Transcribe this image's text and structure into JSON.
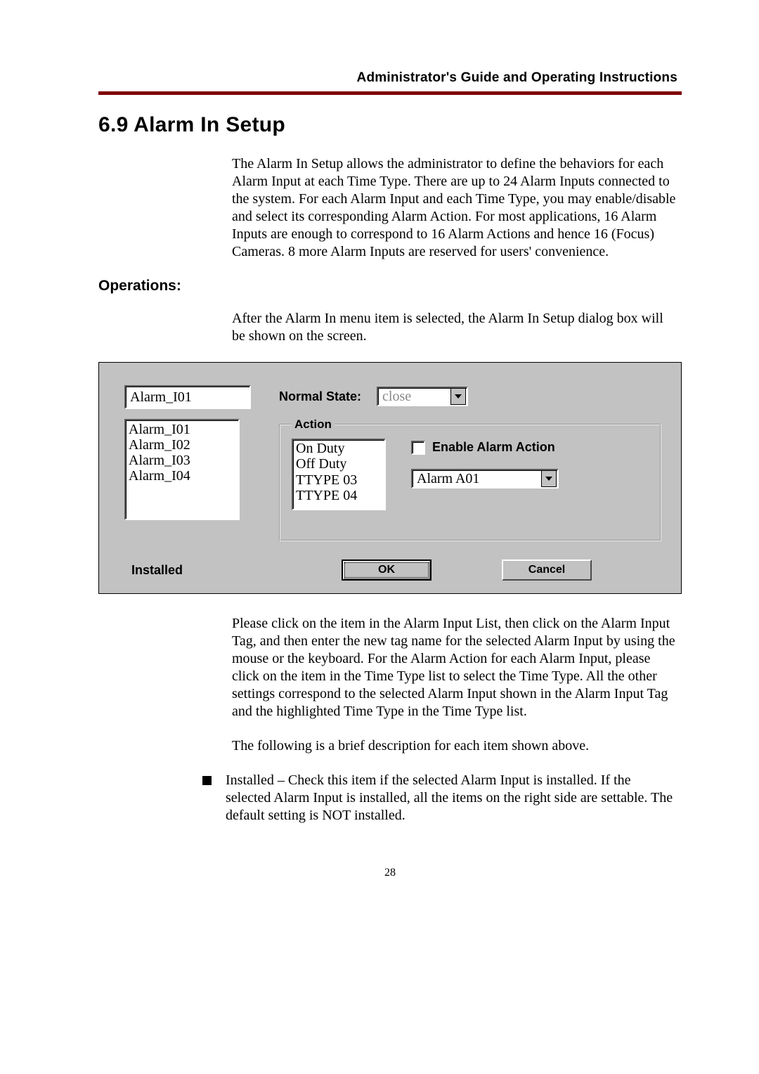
{
  "header": "Administrator's Guide and Operating Instructions",
  "section_title": "6.9 Alarm In Setup",
  "intro": "The Alarm In Setup allows the administrator to define the behaviors for each Alarm Input at each Time Type.    There are up to 24 Alarm Inputs connected to the system.    For each Alarm Input and each Time Type, you may enable/disable and select its corresponding Alarm Action.    For most applications, 16 Alarm Inputs are enough to correspond to 16 Alarm Actions and hence 16 (Focus) Cameras. 8 more Alarm Inputs are reserved for users' convenience.",
  "operations_title": "Operations:",
  "after_menu": "After the Alarm In menu item is selected, the Alarm In Setup dialog box will be shown on the screen.",
  "dialog": {
    "tag_value": "Alarm_I01",
    "ns_label": "Normal State:",
    "ns_value": "close",
    "action_legend": "Action",
    "input_list": [
      "Alarm_I01",
      "Alarm_I02",
      "Alarm_I03",
      "Alarm_I04"
    ],
    "ttype_list": [
      "On Duty",
      "Off Duty",
      "TTYPE 03",
      "TTYPE 04"
    ],
    "enable_label": "Enable Alarm Action",
    "alarm_action_value": "Alarm A01",
    "installed_label": "Installed",
    "ok": "OK",
    "cancel": "Cancel"
  },
  "post_dialog": "Please click on the item in the Alarm Input List, then click on the Alarm Input Tag, and then enter the new tag name for the selected Alarm Input by using the mouse or the keyboard.    For the Alarm Action for each Alarm Input, please click on the item in the Time Type list to select the Time Type.    All the other settings correspond to the selected Alarm Input shown in the Alarm Input Tag and the highlighted Time Type in the Time Type list.",
  "following": "The following is a brief description for each item shown above.",
  "bullet_installed": "Installed – Check this item if the selected Alarm Input is installed. If the selected Alarm Input is installed, all the items on the right side are settable.    The default setting is NOT installed.",
  "page_number": "28"
}
